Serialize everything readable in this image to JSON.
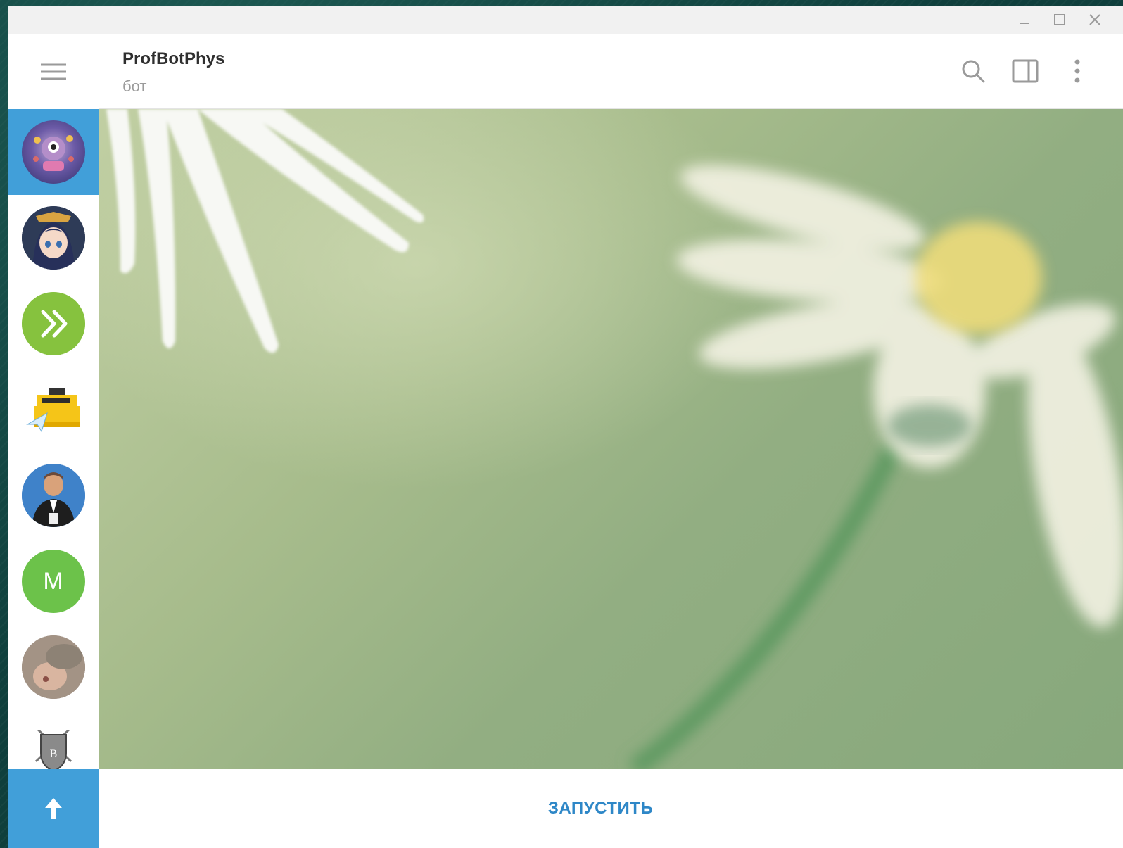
{
  "window": {
    "minimize_icon": "minimize-icon",
    "maximize_icon": "maximize-icon",
    "close_icon": "close-icon"
  },
  "sidebar": {
    "menu_icon": "hamburger-menu-icon",
    "chats": [
      {
        "name": "chat-1",
        "avatar": "cartoon-creature",
        "active": true
      },
      {
        "name": "chat-2",
        "avatar": "anime-girl",
        "active": false
      },
      {
        "name": "chat-3",
        "avatar": "double-chevron-green",
        "active": false
      },
      {
        "name": "chat-4",
        "avatar": "cash-register-bot",
        "active": false
      },
      {
        "name": "chat-5",
        "avatar": "man-in-suit",
        "active": false
      },
      {
        "name": "chat-6",
        "avatar": "letter",
        "letter": "M",
        "active": false
      },
      {
        "name": "chat-7",
        "avatar": "photo-portrait",
        "active": false
      },
      {
        "name": "chat-8",
        "avatar": "shield-crest",
        "active": false
      }
    ],
    "scroll_top_icon": "arrow-up-icon"
  },
  "header": {
    "title": "ProfBotPhys",
    "status": "бот",
    "icons": [
      "search-icon",
      "sidebar-toggle-icon",
      "more-vertical-icon"
    ]
  },
  "colors": {
    "accent": "#419fd9",
    "link": "#2e87c7",
    "avatar_green": "#6cc24a"
  },
  "footer": {
    "start_label": "ЗАПУСТИТЬ"
  }
}
